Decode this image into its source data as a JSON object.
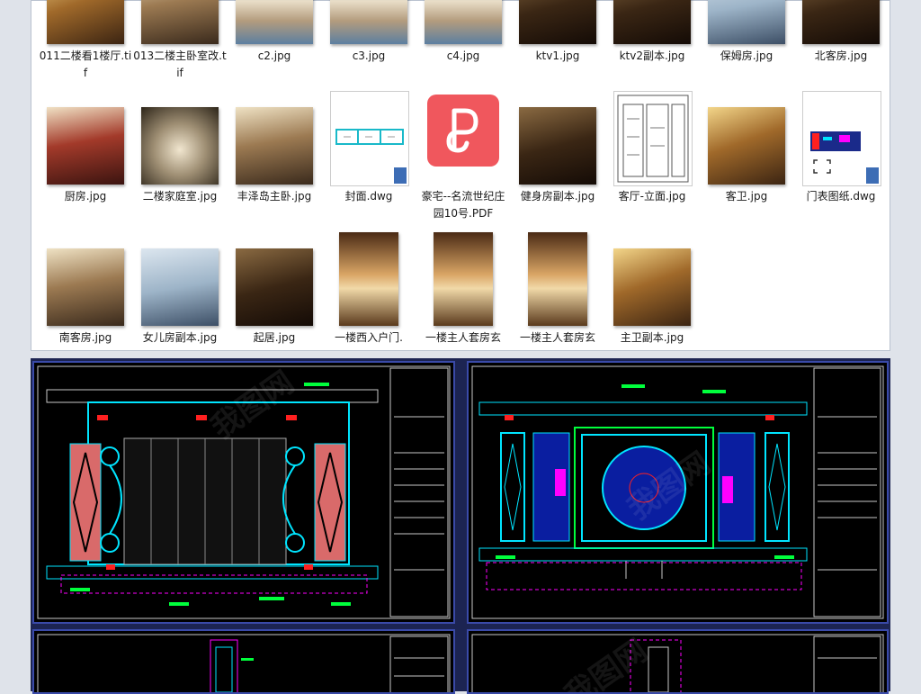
{
  "files": [
    {
      "name": "011二楼看1楼厅.tif",
      "style": "gold"
    },
    {
      "name": "013二楼主卧室改.tif",
      "style": "bedroom"
    },
    {
      "name": "c2.jpg",
      "style": "villa"
    },
    {
      "name": "c3.jpg",
      "style": "villa"
    },
    {
      "name": "c4.jpg",
      "style": "villa"
    },
    {
      "name": "ktv1.jpg",
      "style": "dark"
    },
    {
      "name": "ktv2副本.jpg",
      "style": "dark"
    },
    {
      "name": "保姆房.jpg",
      "style": "blue"
    },
    {
      "name": "北客房.jpg",
      "style": "dark"
    },
    {
      "name": "厨房.jpg",
      "style": "red"
    },
    {
      "name": "二楼家庭室.jpg",
      "style": "arch"
    },
    {
      "name": "丰泽岛主卧.jpg",
      "style": "bedroom"
    },
    {
      "name": "封面.dwg",
      "style": "dwg"
    },
    {
      "name": "豪宅--名流世纪庄园10号.PDF",
      "style": "pdf"
    },
    {
      "name": "健身房副本.jpg",
      "style": "dark"
    },
    {
      "name": "客厅-立面.jpg",
      "style": "sketch"
    },
    {
      "name": "客卫.jpg",
      "style": "gold"
    },
    {
      "name": "门表图纸.dwg",
      "style": "dwg2"
    },
    {
      "name": "南客房.jpg",
      "style": "bedroom"
    },
    {
      "name": "女儿房副本.jpg",
      "style": "blue"
    },
    {
      "name": "起居.jpg",
      "style": "dark"
    },
    {
      "name": "一楼西入户门.",
      "style": "lobby"
    },
    {
      "name": "一楼主人套房玄",
      "style": "lobby"
    },
    {
      "name": "一楼主人套房玄",
      "style": "lobby"
    },
    {
      "name": "主卫副本.jpg",
      "style": "gold"
    }
  ],
  "watermark": "我图网",
  "colors": {
    "cad_bg": "#000000",
    "cad_frame": "#3a4aa8",
    "cyan": "#00e5ff",
    "magenta": "#ff00ff",
    "green": "#00ff3c",
    "red": "#ff2020"
  }
}
